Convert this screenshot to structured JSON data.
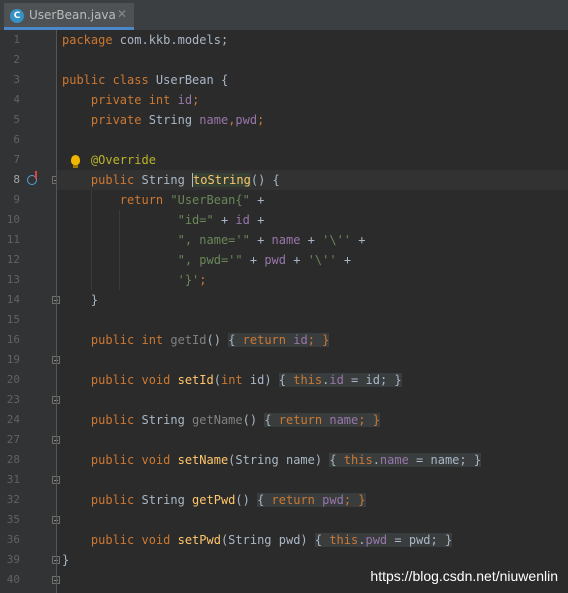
{
  "tab": {
    "filename": "UserBean.java",
    "icon_letter": "C",
    "close": "✕"
  },
  "gutter": {
    "line_numbers": [
      "1",
      "2",
      "3",
      "4",
      "5",
      "6",
      "7",
      "8",
      "9",
      "10",
      "11",
      "12",
      "13",
      "14",
      "15",
      "16",
      "19",
      "20",
      "23",
      "24",
      "27",
      "28",
      "31",
      "32",
      "35",
      "36",
      "39",
      "40"
    ]
  },
  "code": {
    "l1_a": "package",
    "l1_b": " com.kkb.models;",
    "l3_a": "public class",
    "l3_b": " UserBean {",
    "l4_a": "    private int",
    "l4_b": " ",
    "l4_c": "id",
    "l4_d": ";",
    "l5_a": "    private",
    "l5_b": " String ",
    "l5_c": "name",
    "l5_d": ",",
    "l5_e": "pwd",
    "l5_f": ";",
    "l7_a": "    @Override",
    "l8_a": "    public",
    "l8_b": " String ",
    "l8_c": "toString",
    "l8_d": "() {",
    "l9_a": "        return",
    "l9_b": " \"UserBean{\"",
    "l9_c": " +",
    "l10_a": "                ",
    "l10_b": "\"id=\"",
    "l10_c": " + ",
    "l10_d": "id",
    "l10_e": " +",
    "l11_a": "                ",
    "l11_b": "\", name='\"",
    "l11_c": " + ",
    "l11_d": "name",
    "l11_e": " + ",
    "l11_f": "'\\''",
    "l11_g": " +",
    "l12_a": "                ",
    "l12_b": "\", pwd='\"",
    "l12_c": " + ",
    "l12_d": "pwd",
    "l12_e": " + ",
    "l12_f": "'\\''",
    "l12_g": " +",
    "l13_a": "                ",
    "l13_b": "'}'",
    "l13_c": ";",
    "l14_a": "    }",
    "l16_a": "    public int",
    "l16_b": " getId",
    "l16_c": "() ",
    "l16_d": "{ ",
    "l16_e": "return",
    "l16_f": " ",
    "l16_g": "id",
    "l16_h": "; }",
    "l20_a": "    public void",
    "l20_b": " setId",
    "l20_c": "(",
    "l20_d": "int",
    "l20_e": " id) ",
    "l20_f": "{ ",
    "l20_g": "this",
    "l20_h": ".",
    "l20_i": "id",
    "l20_j": " = id; }",
    "l24_a": "    public",
    "l24_b": " String ",
    "l24_c": "getName",
    "l24_d": "() ",
    "l24_e": "{ ",
    "l24_f": "return",
    "l24_g": " ",
    "l24_h": "name",
    "l24_i": "; }",
    "l28_a": "    public void",
    "l28_b": " setName",
    "l28_c": "(String name) ",
    "l28_d": "{ ",
    "l28_e": "this",
    "l28_f": ".",
    "l28_g": "name",
    "l28_h": " = name; }",
    "l32_a": "    public",
    "l32_b": " String ",
    "l32_c": "getPwd",
    "l32_d": "() ",
    "l32_e": "{ ",
    "l32_f": "return",
    "l32_g": " ",
    "l32_h": "pwd",
    "l32_i": "; }",
    "l36_a": "    public void",
    "l36_b": " setPwd",
    "l36_c": "(String pwd) ",
    "l36_d": "{ ",
    "l36_e": "this",
    "l36_f": ".",
    "l36_g": "pwd",
    "l36_h": " = pwd; }",
    "l39_a": "}"
  },
  "watermark": "https://blog.csdn.net/niuwenlin",
  "colors": {
    "background": "#2b2b2b",
    "gutter": "#313335",
    "keyword": "#cc7832",
    "field": "#9876aa",
    "string": "#6a8759",
    "annotation": "#bbb529",
    "method": "#ffc66d",
    "text": "#a9b7c6"
  }
}
